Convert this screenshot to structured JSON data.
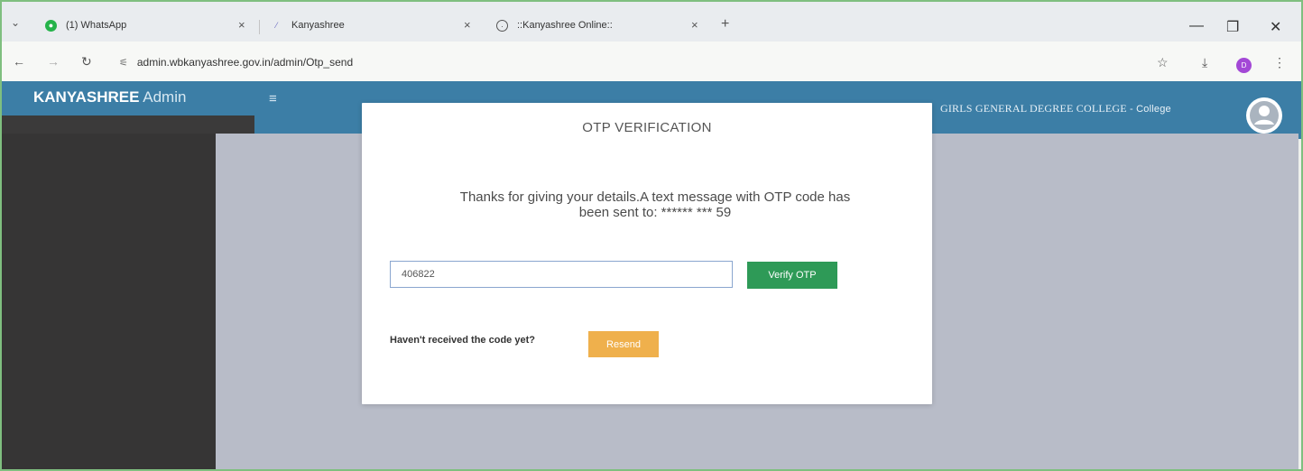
{
  "browser": {
    "tab_menu_icon": "chevron-down-icon",
    "tabs": [
      {
        "label": "(1) WhatsApp",
        "icon": "whatsapp-icon"
      },
      {
        "label": "Kanyashree",
        "icon": "kanyashree-icon"
      },
      {
        "label": "::Kanyashree Online::",
        "icon": "globe-icon"
      }
    ],
    "new_tab": "+",
    "window_controls": {
      "minimize": "—",
      "restore": "❐",
      "close": "✕"
    },
    "address": "admin.wbkanyashree.gov.in/admin/Otp_send",
    "profile_initial": "D"
  },
  "app": {
    "brand_bold": "KANYASHREE",
    "brand_light": " Admin",
    "hamburger": "≡",
    "college_name": "GIRLS GENERAL DEGREE COLLEGE",
    "college_role": "- College"
  },
  "modal": {
    "title": "OTP VERIFICATION",
    "message_line1": "Thanks for giving your details.A text message with OTP code has",
    "message_line2": "been sent to: ****** *** 59",
    "otp_value": "406822",
    "verify_label": "Verify OTP",
    "resend_prompt": "Haven't received the code yet?",
    "resend_label": "Resend"
  },
  "colors": {
    "header": "#3c7ea6",
    "verify": "#2e9a57",
    "resend": "#efb04c"
  }
}
